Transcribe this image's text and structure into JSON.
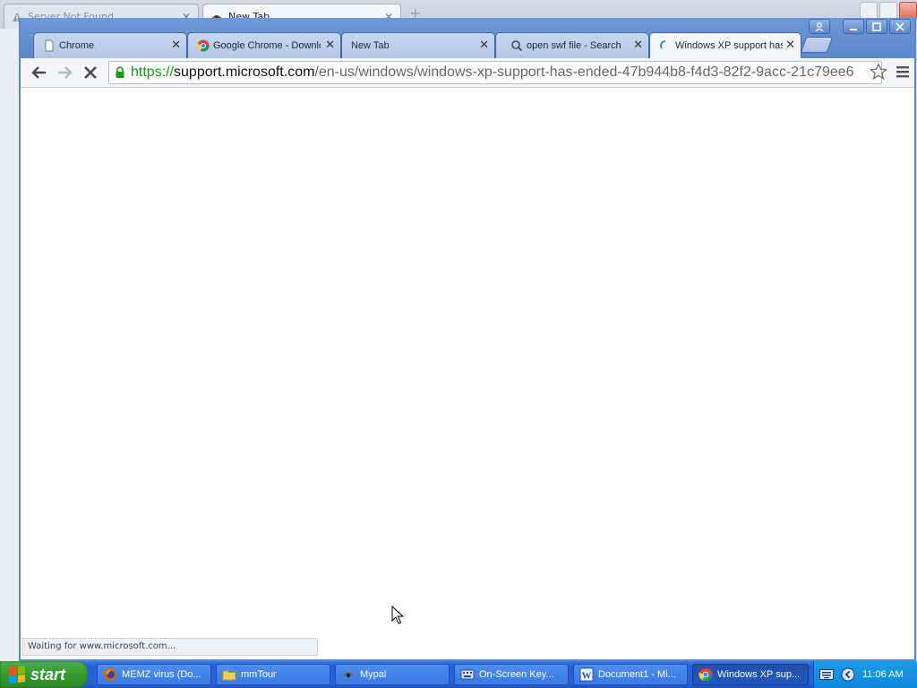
{
  "background_window": {
    "tabs": [
      {
        "label": "Server Not Found",
        "icon": "warning-icon"
      },
      {
        "label": "New Tab",
        "icon": "mypal-icon"
      }
    ]
  },
  "tabs": [
    {
      "label": "Chrome",
      "icon": "document-icon",
      "active": false
    },
    {
      "label": "Google Chrome - Downlo",
      "icon": "chrome-icon",
      "active": false
    },
    {
      "label": "New Tab",
      "icon": "none",
      "active": false
    },
    {
      "label": "open swf file - Search",
      "icon": "search-icon",
      "active": false
    },
    {
      "label": "Windows XP support has",
      "icon": "loading-spinner-icon",
      "active": true
    }
  ],
  "address_bar": {
    "scheme": "https://",
    "host": "support.microsoft.com",
    "path": "/en-us/windows/windows-xp-support-has-ended-47b944b8-f4d3-82f2-9acc-21c79ee6"
  },
  "status_text": "Waiting for www.microsoft.com...",
  "taskbar": {
    "start_label": "start",
    "items": [
      {
        "label": "MEMZ virus (Do...",
        "icon": "firefox-icon",
        "active": false
      },
      {
        "label": "mmTour",
        "icon": "folder-icon",
        "active": false
      },
      {
        "label": "Mypal",
        "icon": "mypal-icon",
        "active": false
      },
      {
        "label": "On-Screen Key...",
        "icon": "keyboard-icon",
        "active": false
      },
      {
        "label": "Document1 - Mi...",
        "icon": "word-icon",
        "active": false
      },
      {
        "label": "Windows XP sup...",
        "icon": "chrome-icon",
        "active": true
      }
    ],
    "clock": "11:06 AM"
  },
  "colors": {
    "titlebar": "#5c88cc",
    "taskbar": "#245edb",
    "start_green": "#379e2f",
    "url_secure_green": "#179a17"
  }
}
